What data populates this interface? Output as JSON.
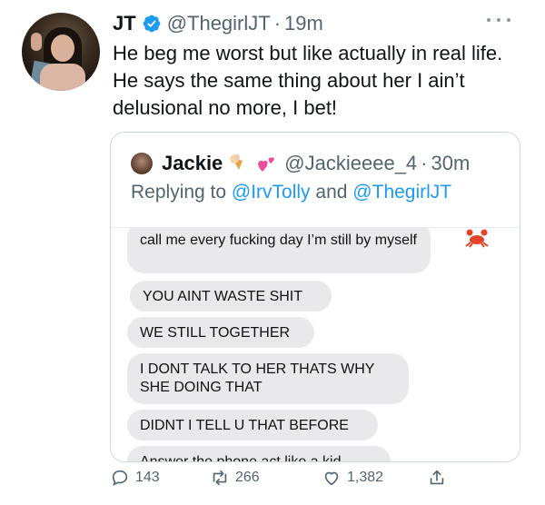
{
  "tweet": {
    "author_name": "JT",
    "author_handle": "@ThegirlJT",
    "separator": "·",
    "time": "19m",
    "text": "He beg me worst but like actually in real life. He says the same thing about her I ain’t delusional no more, I bet!"
  },
  "quoted": {
    "author_name": "Jackie",
    "author_handle": "@Jackieeee_4",
    "separator": "·",
    "time": "30m",
    "replying_prefix": "Replying to",
    "reply_user1": "@IrvTolly",
    "reply_and": "and",
    "reply_user2": "@ThegirlJT",
    "messages": [
      "call me every fucking day I’m still by myself",
      "YOU AINT WASTE SHIT",
      "WE STILL TOGETHER",
      "I DONT TALK TO HER THATS WHY SHE DOING THAT",
      "DIDNT I TELL U THAT BEFORE",
      "Answer the phone act like a kid"
    ]
  },
  "actions": {
    "replies": "143",
    "retweets": "266",
    "likes": "1,382"
  },
  "colors": {
    "verified_blue": "#1d9bf0",
    "link_blue": "#1d9bf0",
    "secondary_text": "#536471",
    "bubble_gray": "#e9e9eb"
  },
  "icons": [
    "verified-badge-icon",
    "more-icon",
    "reply-icon",
    "retweet-icon",
    "like-icon",
    "share-icon",
    "ice-cream-emoji-icon",
    "two-hearts-emoji-icon",
    "crab-emoji-icon"
  ]
}
